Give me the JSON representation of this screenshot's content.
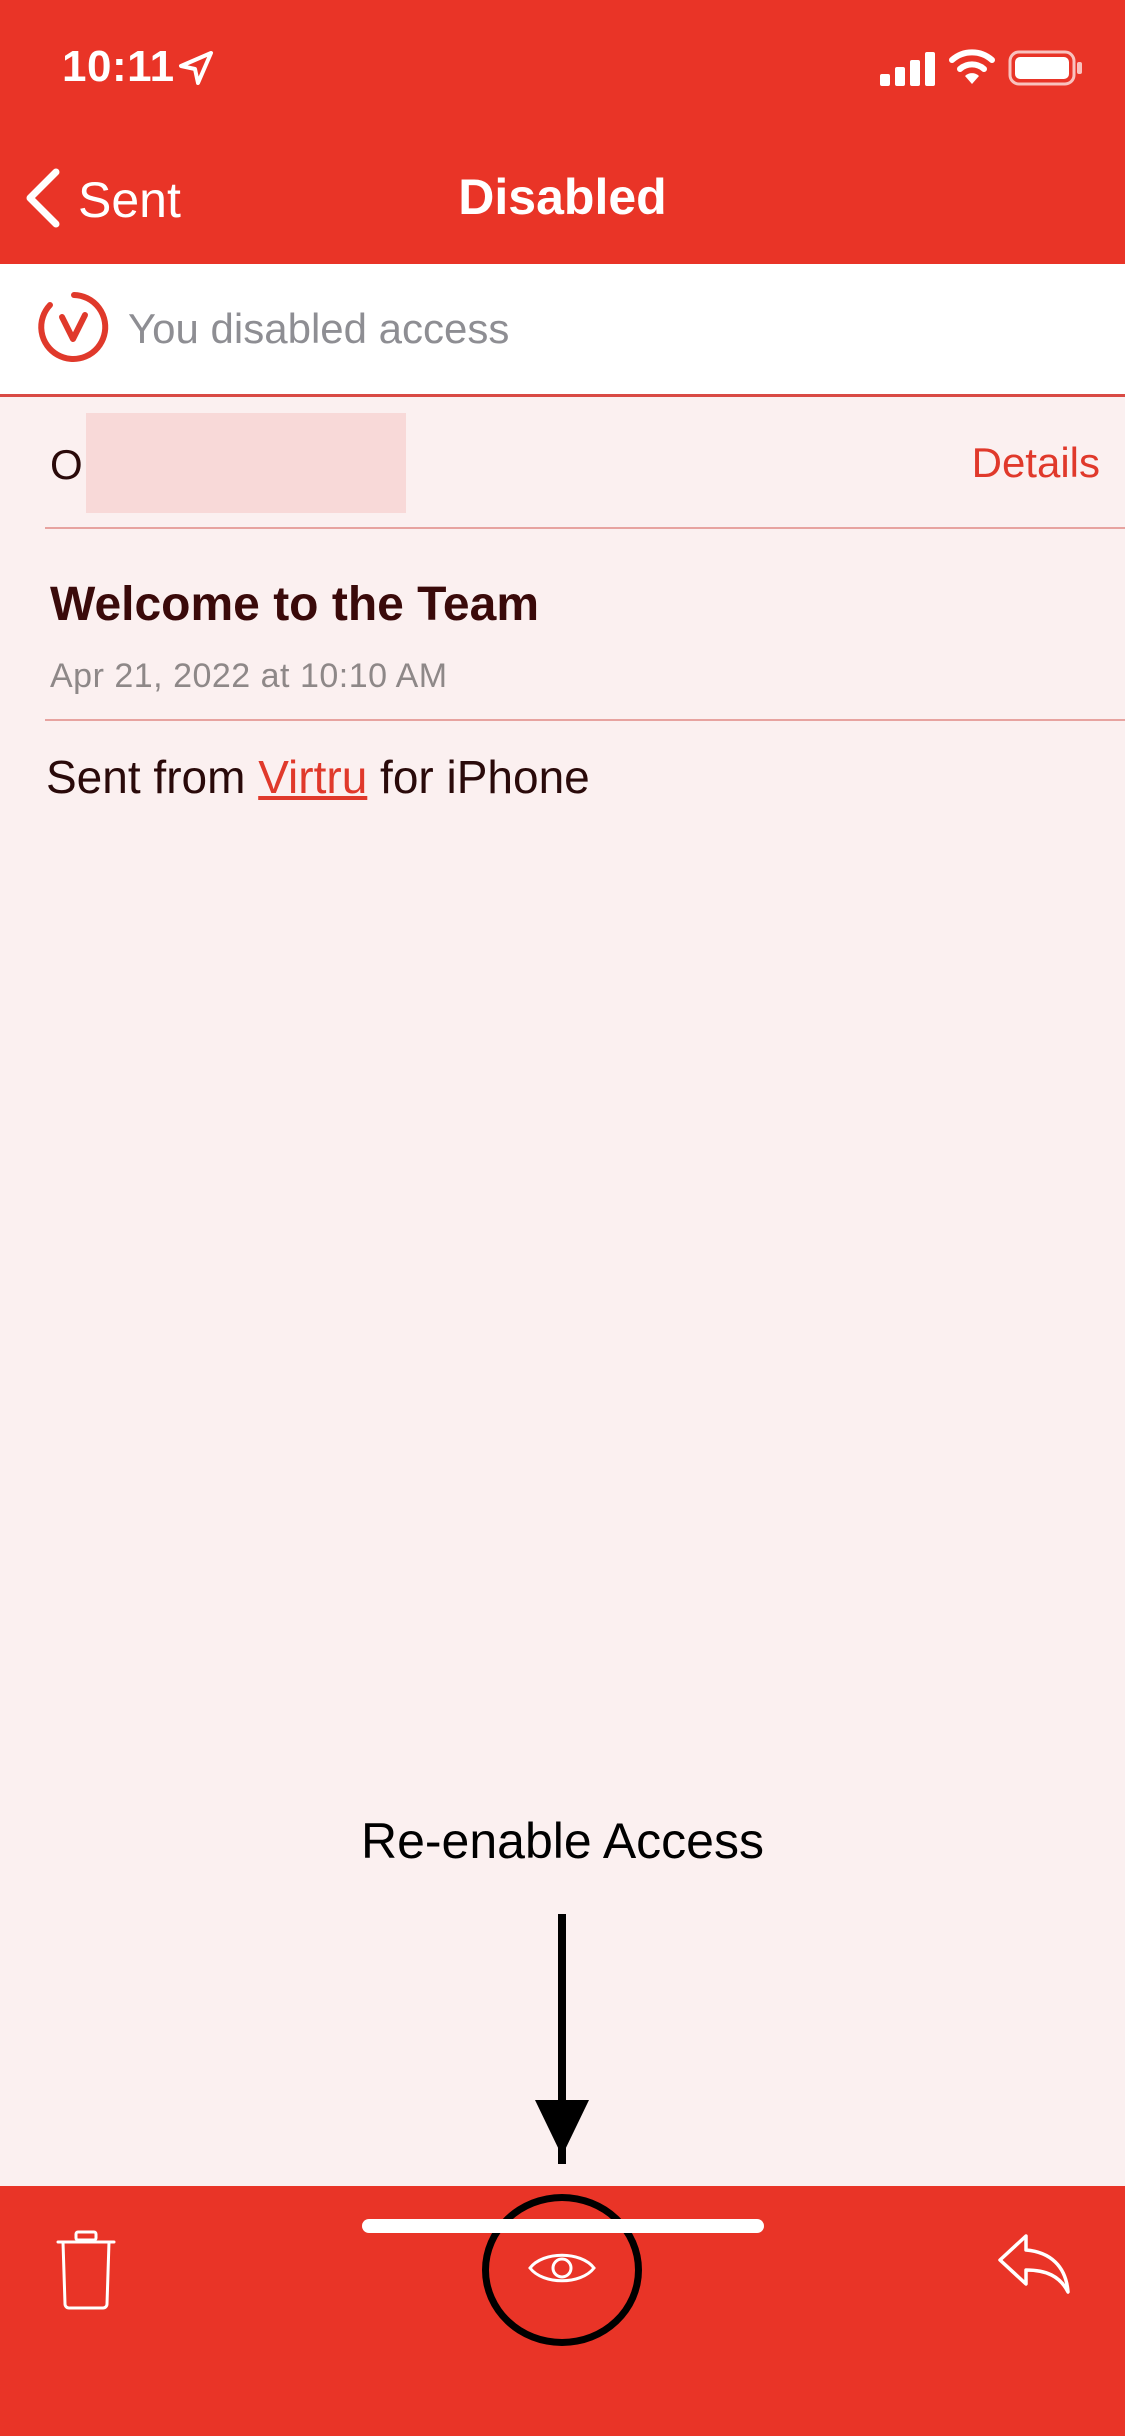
{
  "status_bar": {
    "time": "10:11"
  },
  "nav": {
    "back_label": "Sent",
    "title": "Disabled"
  },
  "banner": {
    "text": "You disabled access"
  },
  "message": {
    "sender_initial": "O",
    "details_label": "Details",
    "subject": "Welcome to the Team",
    "date": "Apr 21, 2022 at 10:10 AM",
    "body_prefix": "Sent from ",
    "body_link": "Virtru",
    "body_suffix": " for iPhone"
  },
  "annotation": {
    "label": "Re-enable Access"
  },
  "colors": {
    "header_red": "#E93427",
    "page_background": "#FBF0F0",
    "accent_red": "#E0392B"
  },
  "icons": {
    "back": "chevron-left-icon",
    "location": "location-arrow-icon",
    "signal": "signal-icon",
    "wifi": "wifi-icon",
    "battery": "battery-icon",
    "virtru": "virtru-logo-icon",
    "trash": "trash-icon",
    "eye": "eye-icon",
    "reply": "reply-icon"
  }
}
